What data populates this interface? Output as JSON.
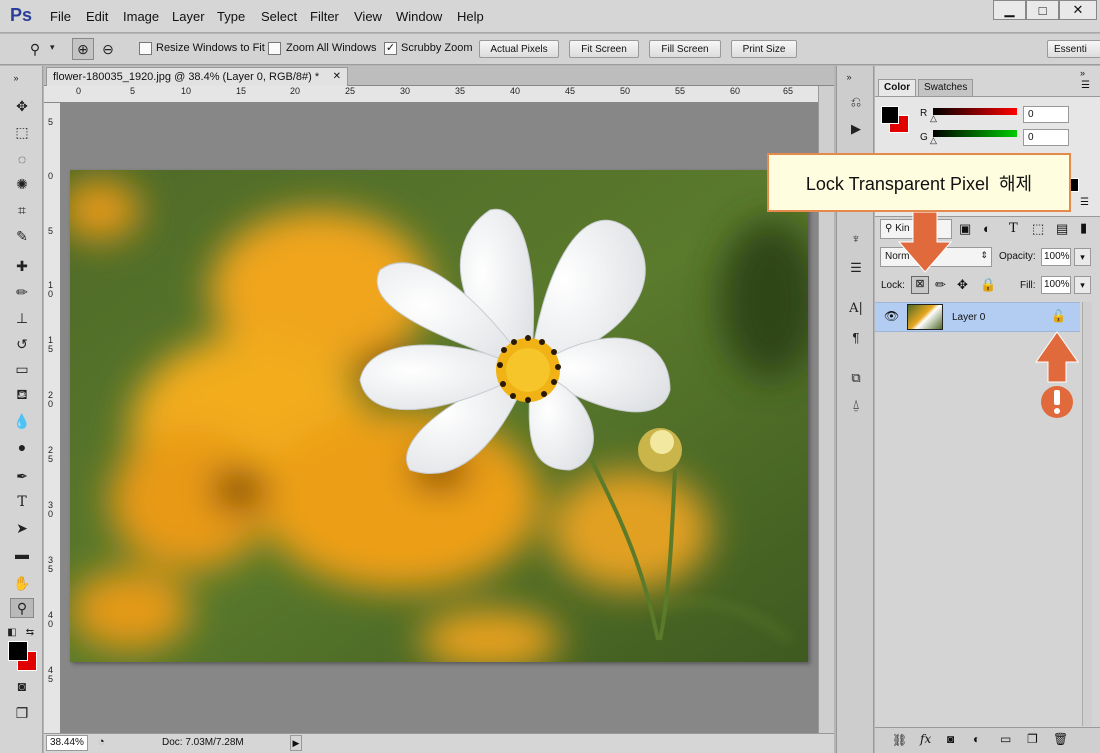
{
  "app": {
    "logo": "Ps"
  },
  "menu": [
    "File",
    "Edit",
    "Image",
    "Layer",
    "Type",
    "Select",
    "Filter",
    "View",
    "Window",
    "Help"
  ],
  "window_controls": {
    "minimize": "▁",
    "maximize": "□",
    "close": "✕"
  },
  "options": {
    "resize_windows_to_fit": {
      "label": "Resize Windows to Fit",
      "checked": false
    },
    "zoom_all_windows": {
      "label": "Zoom All Windows",
      "checked": false
    },
    "scrubby_zoom": {
      "label": "Scrubby Zoom",
      "checked": true
    },
    "check_mark": "✓",
    "buttons": [
      "Actual Pixels",
      "Fit Screen",
      "Fill Screen",
      "Print Size"
    ],
    "workspace": "Essenti"
  },
  "document": {
    "tab_title": "flower-180035_1920.jpg @ 38.4% (Layer 0, RGB/8#) *",
    "close": "✕"
  },
  "ruler": {
    "h": [
      "0",
      "5",
      "10",
      "15",
      "20",
      "25",
      "30",
      "35",
      "40",
      "45",
      "50",
      "55",
      "60",
      "65"
    ],
    "v": [
      "5",
      "0",
      "5",
      "1 0",
      "1 5",
      "2 0",
      "2 5",
      "3 0",
      "3 5",
      "4 0",
      "4 5"
    ]
  },
  "status": {
    "zoom": "38.44%",
    "doc": "Doc: 7.03M/7.28M",
    "arrow": "▶"
  },
  "color_panel": {
    "tabs": [
      "Color",
      "Swatches"
    ],
    "r_label": "R",
    "g_label": "G",
    "r_value": "0",
    "g_value": "0"
  },
  "layers_panel": {
    "kind_label": "Kin",
    "blend_mode": "Norm",
    "opacity_label": "Opacity:",
    "opacity_value": "100%",
    "lock_label": "Lock:",
    "fill_label": "Fill:",
    "fill_value": "100%",
    "layer_name": "Layer 0"
  },
  "callout": {
    "text": "Lock Transparent Pixel  해제"
  },
  "colors": {
    "accent_arrow": "#e06a3c",
    "layer_selected": "#b3cdf2",
    "callout_bg": "#fffde0"
  }
}
